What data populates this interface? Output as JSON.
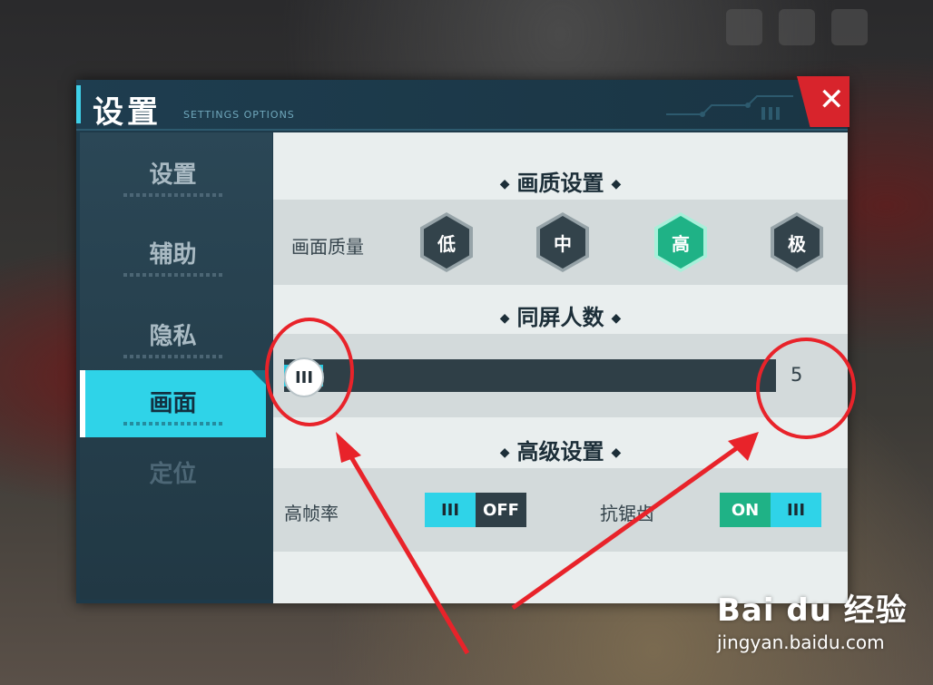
{
  "dialog": {
    "title": "设置",
    "subtitle": "SETTINGS OPTIONS",
    "close_glyph": "✕"
  },
  "sidebar": {
    "items": [
      {
        "label": "设置"
      },
      {
        "label": "辅助"
      },
      {
        "label": "隐私"
      },
      {
        "label": "画面",
        "active": true
      },
      {
        "label": "定位"
      }
    ]
  },
  "quality_section": {
    "title": "画质设置",
    "row_label": "画面质量",
    "options": [
      "低",
      "中",
      "高",
      "极"
    ],
    "selected": "高"
  },
  "players_section": {
    "title": "同屏人数",
    "value": "5",
    "knob_glyph": "III",
    "slider_fill_fraction": 0.08
  },
  "advanced_section": {
    "title": "高级设置",
    "high_framerate": {
      "label": "高帧率",
      "knob": "III",
      "state": "OFF"
    },
    "antialias": {
      "label": "抗锯齿",
      "state": "ON",
      "knob": "III"
    }
  },
  "watermark": {
    "logo": "Bai du 经验",
    "url": "jingyan.baidu.com"
  },
  "colors": {
    "accent": "#2fd3e8",
    "selected_green": "#1fb286",
    "annotation_red": "#e8232a"
  }
}
